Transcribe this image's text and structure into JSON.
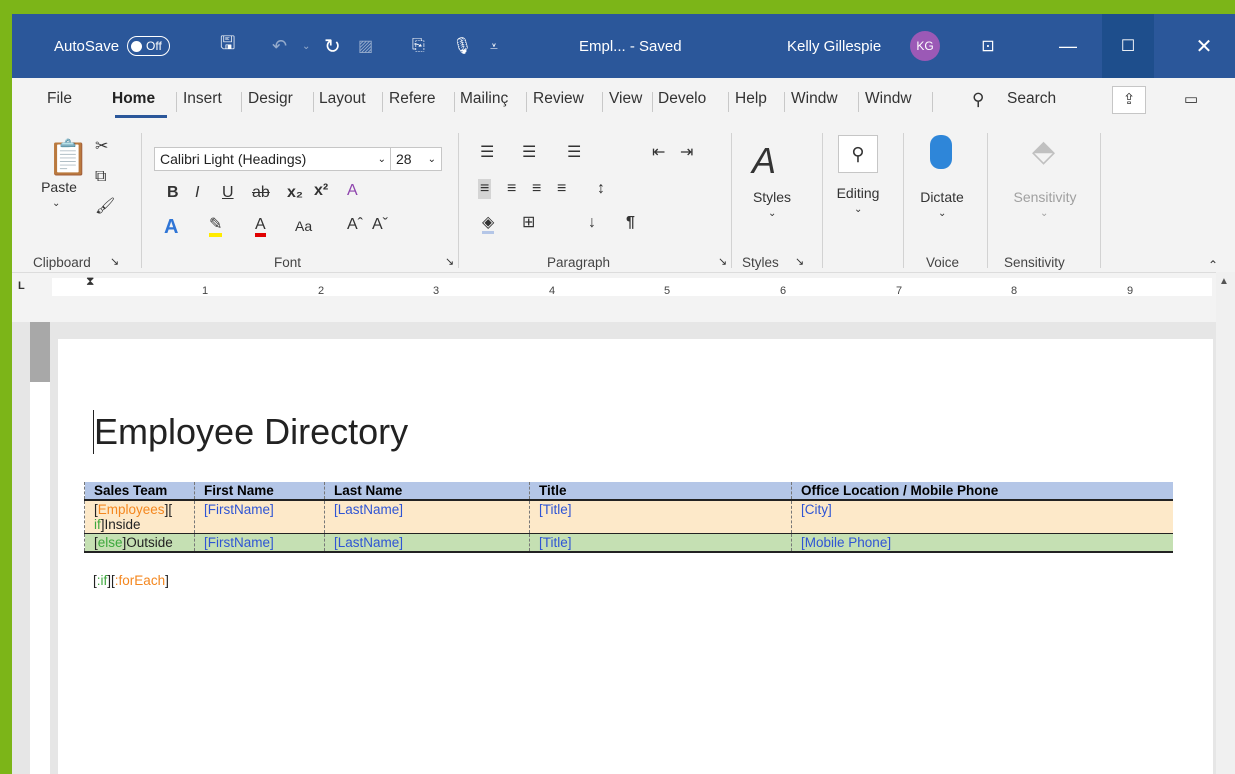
{
  "titlebar": {
    "autosave_label": "AutoSave",
    "autosave_state": "Off",
    "doc_title": "Empl...  -  Saved",
    "user_name": "Kelly Gillespie",
    "user_initials": "KG"
  },
  "tabs": [
    "File",
    "Home",
    "Insert",
    "Desigr",
    "Layout",
    "Refere",
    "Mailinç",
    "Review",
    "View",
    "Develo",
    "Help",
    "Windw",
    "Windw"
  ],
  "search_label": "Search",
  "ribbon": {
    "paste_label": "Paste",
    "font_name": "Calibri Light (Headings)",
    "font_size": "28",
    "styles_label": "Styles",
    "editing_label": "Editing",
    "dictate_label": "Dictate",
    "sensitivity_label": "Sensitivity",
    "groups": {
      "clipboard": "Clipboard",
      "font": "Font",
      "paragraph": "Paragraph",
      "styles": "Styles",
      "voice": "Voice",
      "sensitivity": "Sensitivity"
    }
  },
  "ruler_numbers": [
    "1",
    "2",
    "3",
    "4",
    "5",
    "6",
    "7",
    "8",
    "9"
  ],
  "document": {
    "title": "Employee Directory",
    "table": {
      "headers": [
        "Sales Team",
        "First Name",
        "Last Name",
        "Title",
        "Office Location / Mobile Phone"
      ],
      "row1": {
        "c1_open": "[",
        "c1_tag": "Employees",
        "c1_mid": "][",
        "c1_if": "if",
        "c1_tail": "]Inside",
        "first": "FirstName",
        "last": "LastName",
        "title": "Title",
        "loc": "City"
      },
      "row2": {
        "c1_open": "[",
        "c1_else": "else",
        "c1_tail": "]Outside",
        "first": "FirstName",
        "last": "LastName",
        "title": "Title",
        "loc": "Mobile Phone"
      }
    },
    "post": {
      "open1": "[",
      "endif": ":if",
      "mid": "][",
      "endfor": ":forEach",
      "close": "]"
    }
  },
  "colors": {
    "titlebar": "#2b579a",
    "header_row": "#b4c6e7",
    "row_inside": "#fde9c9",
    "row_outside": "#c5e0b3",
    "field_text": "#2f55d4",
    "tag_orange": "#f4871f",
    "tag_green": "#3da83d"
  }
}
